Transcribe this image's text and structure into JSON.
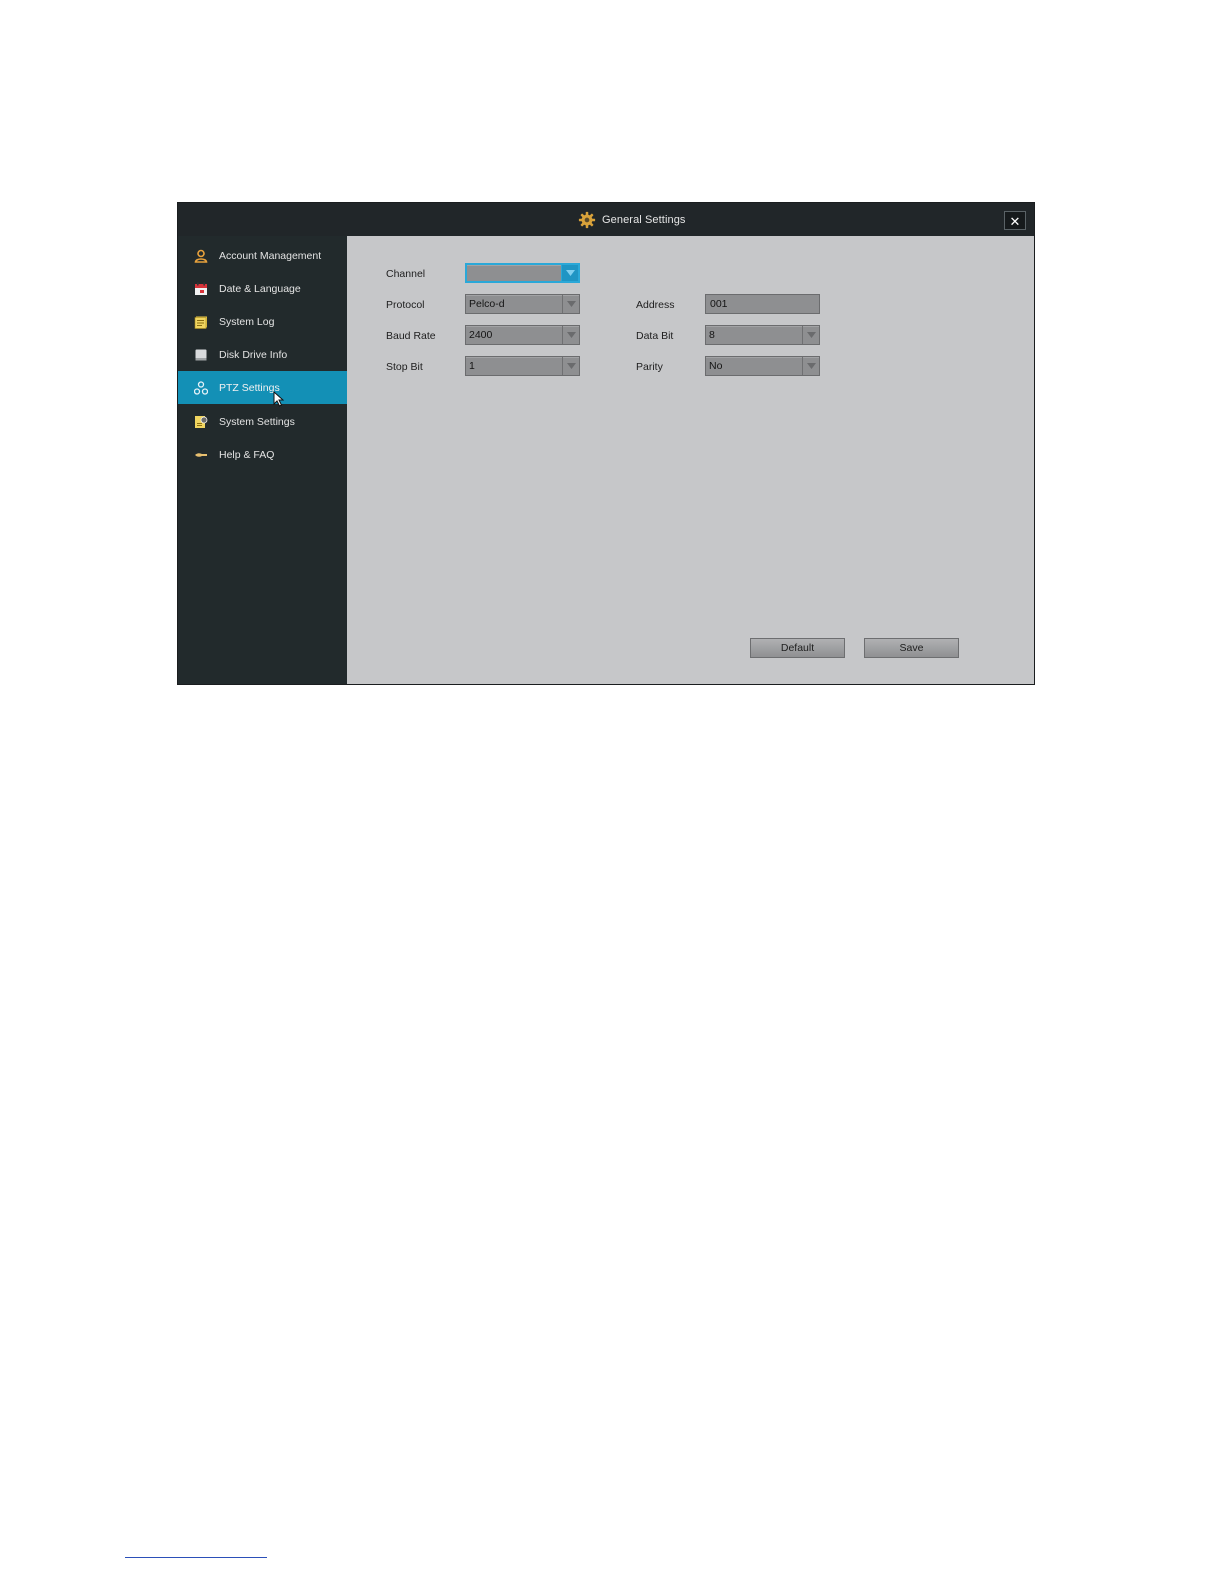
{
  "window": {
    "title": "General Settings",
    "close_label": "✕"
  },
  "sidebar": {
    "items": [
      {
        "label": "Account Management",
        "icon": "user-icon",
        "active": false
      },
      {
        "label": "Date & Language",
        "icon": "calendar-icon",
        "active": false
      },
      {
        "label": "System Log",
        "icon": "log-icon",
        "active": false
      },
      {
        "label": "Disk Drive Info",
        "icon": "disk-icon",
        "active": false
      },
      {
        "label": "PTZ Settings",
        "icon": "ptz-icon",
        "active": true
      },
      {
        "label": "System Settings",
        "icon": "system-settings-icon",
        "active": false
      },
      {
        "label": "Help & FAQ",
        "icon": "help-icon",
        "active": false
      }
    ]
  },
  "form": {
    "channel": {
      "label": "Channel",
      "value": ""
    },
    "protocol": {
      "label": "Protocol",
      "value": "Pelco-d"
    },
    "baud_rate": {
      "label": "Baud Rate",
      "value": "2400"
    },
    "stop_bit": {
      "label": "Stop Bit",
      "value": "1"
    },
    "address": {
      "label": "Address",
      "value": "001"
    },
    "data_bit": {
      "label": "Data Bit",
      "value": "8"
    },
    "parity": {
      "label": "Parity",
      "value": "No"
    }
  },
  "buttons": {
    "default_label": "Default",
    "save_label": "Save"
  },
  "colors": {
    "titlebar": "#212629",
    "sidebar": "#222a2c",
    "active_item": "#1390b6",
    "content_bg": "#c6c7c9",
    "focus": "#2aa8d8"
  }
}
